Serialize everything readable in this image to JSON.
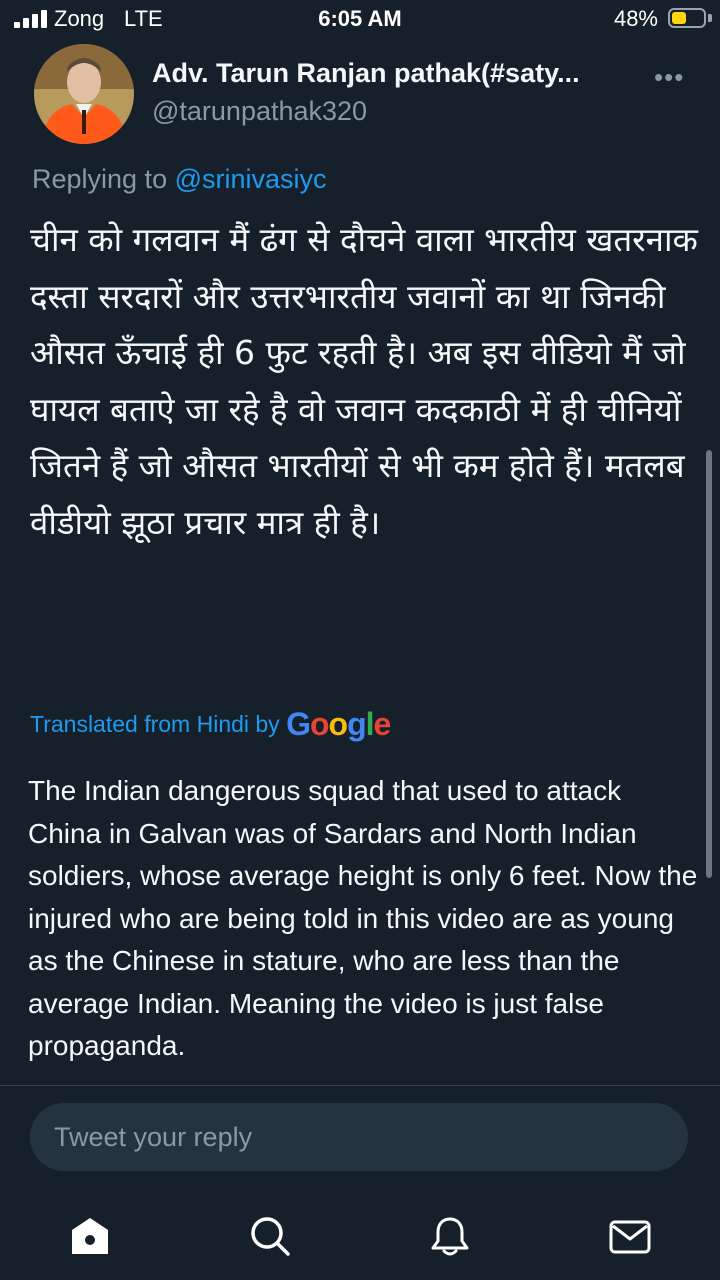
{
  "status_bar": {
    "carrier": "Zong",
    "network": "LTE",
    "time": "6:05 AM",
    "battery_percent": "48%",
    "battery_level": 0.48,
    "battery_color": "#ffd60a"
  },
  "tweet": {
    "author_name": "Adv. Tarun Ranjan pathak(#saty...",
    "author_handle": "@tarunpathak320",
    "more_icon": "more-horizontal-icon",
    "replying_prefix": "Replying to",
    "replying_to": "@srinivasiyc",
    "text_hindi": "चीन को गलवान मैं ढंग से दौचने वाला भारतीय खतरनाक दस्ता सरदारों और उत्तरभारतीय जवानों का था जिनकी औसत ऊँचाई ही 6 फुट रहती है। अब इस वीडियो मैं जो घायल बताऐ जा रहे है वो जवान कदकाठी में ही चीनियों जितने हैं जो औसत भारतीयों से भी कम होते हैं। मतलब वीडीयो झूठा प्रचार मात्र ही है।",
    "translated_label": "Translated from Hindi by",
    "translation_provider": "Google",
    "text_english": "The Indian dangerous squad that used to attack China in Galvan was of Sardars and North Indian soldiers, whose average height is only 6 feet. Now the injured who are being told in this video are as young as the Chinese in stature, who are less than the average Indian. Meaning the video is just false propaganda."
  },
  "reply": {
    "placeholder": "Tweet your reply"
  },
  "tabbar": {
    "items": [
      {
        "icon": "home-icon"
      },
      {
        "icon": "search-icon"
      },
      {
        "icon": "notifications-bell-icon"
      },
      {
        "icon": "messages-mail-icon"
      }
    ]
  },
  "colors": {
    "background": "#15202b",
    "accent": "#1d9bf0",
    "secondary_text": "#8b98a5"
  }
}
